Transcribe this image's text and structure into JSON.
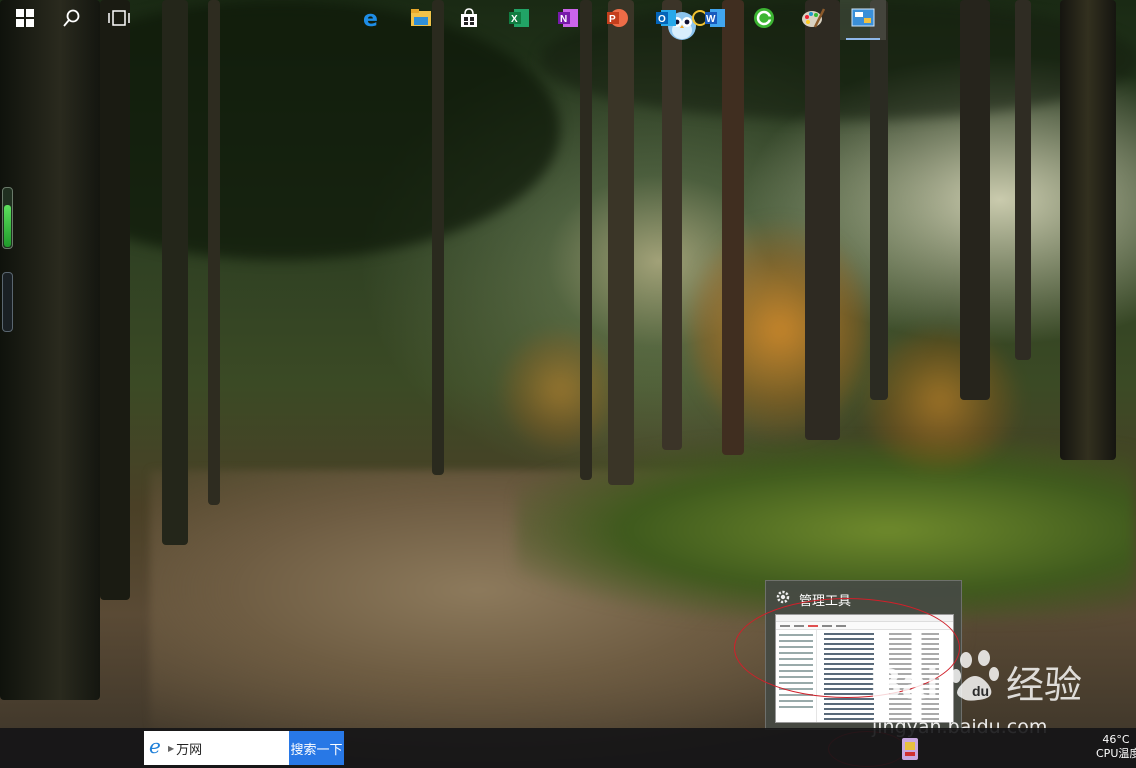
{
  "desktop": {
    "wallpaper": "forest-path-wallpaper"
  },
  "preview": {
    "title": "管理工具"
  },
  "taskbar": {
    "search_text": "万网",
    "search_button": "搜索一下",
    "apps": [
      "start-icon",
      "search-icon",
      "task-view-icon",
      "edge-icon",
      "file-explorer-icon",
      "store-icon",
      "excel-icon",
      "onenote-icon",
      "powerpoint-icon",
      "outlook-icon",
      "word-icon",
      "360-browser-icon",
      "paint-icon",
      "control-panel-icon"
    ]
  },
  "tray": {
    "temperature": "46°C",
    "label": "CPU温度"
  },
  "watermark": {
    "brand": "Baidu经验",
    "url": "jingyan.baidu.com"
  },
  "colors": {
    "accent": "#2878e6",
    "highlight_ring": "#d0202a"
  }
}
